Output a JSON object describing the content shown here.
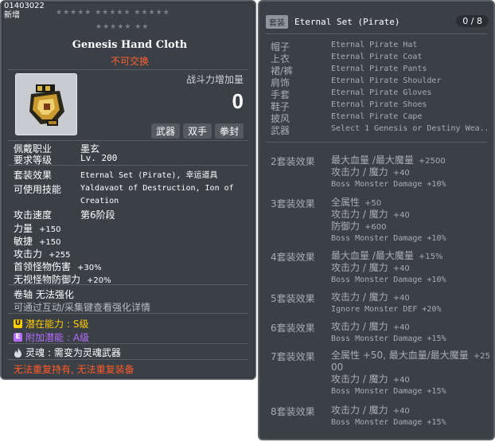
{
  "item": {
    "id": "01403022",
    "new_label": "新增",
    "stars_row1": "★★★★★ ★★★★★ ★★★★★",
    "stars_row2": "★★★★★ ★★",
    "name": "Genesis Hand Cloth",
    "trade_status": "不可交换",
    "power_label": "战斗力增加量",
    "power_value": "0",
    "tags": [
      "武器",
      "双手",
      "拳封"
    ],
    "icon": "gloves-icon"
  },
  "requirements": [
    {
      "key": "佩戴职业",
      "value": "墨玄"
    },
    {
      "key": "要求等级",
      "value": "Lv. 200"
    }
  ],
  "set_effect": {
    "key": "套装效果",
    "value": "Eternal Set (Pirate), 幸运道具"
  },
  "skills": {
    "key": "可使用技能",
    "value": "Yaldavaot of Destruction, Ion of Creation"
  },
  "attack_speed": {
    "key": "攻击速度",
    "value": "第6阶段"
  },
  "stats": [
    {
      "name": "力量",
      "value": "+150"
    },
    {
      "name": "敏捷",
      "value": "+150"
    },
    {
      "name": "攻击力",
      "value": "+255"
    },
    {
      "name": "首领怪物伤害",
      "value": "+30%"
    },
    {
      "name": "无视怪物防御力",
      "value": "+20%"
    }
  ],
  "scroll": {
    "label": "卷轴",
    "value": "无法强化"
  },
  "enhance_hint": "可通过互动/采集键查看强化详情",
  "potential": {
    "badge": "U",
    "label": "潜在能力",
    "value": ": S级",
    "color": "#ffcc00"
  },
  "bonus_potential": {
    "badge": "E",
    "label": "附加潜能",
    "value": ": A级",
    "color": "#b56cff"
  },
  "soul": {
    "label": "灵魂",
    "value": ": 需变为灵魂武器"
  },
  "warning": "无法重复持有, 无法重复装备",
  "set": {
    "badge": "套装",
    "title": "Eternal Set (Pirate)",
    "count": "0 / 8",
    "pieces": [
      {
        "slot": "帽子",
        "name": "Eternal Pirate Hat"
      },
      {
        "slot": "上衣",
        "name": "Eternal Pirate Coat"
      },
      {
        "slot": "裙/裤",
        "name": "Eternal Pirate Pants"
      },
      {
        "slot": "肩饰",
        "name": "Eternal Pirate Shoulder"
      },
      {
        "slot": "手套",
        "name": "Eternal Pirate Gloves"
      },
      {
        "slot": "鞋子",
        "name": "Eternal Pirate Shoes"
      },
      {
        "slot": "披风",
        "name": "Eternal Pirate Cape"
      },
      {
        "slot": "武器",
        "name": "Select 1 Genesis or Destiny Wea.."
      }
    ],
    "bonuses": [
      {
        "label": "2套装效果",
        "lines": [
          {
            "text": "最大血量 /最大魔量",
            "num": "+2500"
          },
          {
            "text": "攻击力 / 魔力",
            "num": "+40"
          },
          {
            "mono": "Boss Monster Damage +10%"
          }
        ]
      },
      {
        "label": "3套装效果",
        "lines": [
          {
            "text": "全属性",
            "num": "+50"
          },
          {
            "text": "攻击力 / 魔力",
            "num": "+40"
          },
          {
            "text": "防御力",
            "num": "+600"
          },
          {
            "mono": "Boss Monster Damage +10%"
          }
        ]
      },
      {
        "label": "4套装效果",
        "lines": [
          {
            "text": "最大血量 /最大魔量",
            "num": "+15%"
          },
          {
            "text": "攻击力 / 魔力",
            "num": "+40"
          },
          {
            "mono": "Boss Monster Damage +10%"
          }
        ]
      },
      {
        "label": "5套装效果",
        "lines": [
          {
            "text": "攻击力 / 魔力",
            "num": "+40"
          },
          {
            "mono": "Ignore Monster DEF +20%"
          }
        ]
      },
      {
        "label": "6套装效果",
        "lines": [
          {
            "text": "攻击力 / 魔力",
            "num": "+40"
          },
          {
            "mono": "Boss Monster Damage +15%"
          }
        ]
      },
      {
        "label": "7套装效果",
        "lines": [
          {
            "text": "全属性 +50, 最大血量/最大魔量",
            "num": "+25"
          },
          {
            "text": "00",
            "num": ""
          },
          {
            "text": "攻击力 / 魔力",
            "num": "+40"
          },
          {
            "mono": "Boss Monster Damage +15%"
          }
        ]
      },
      {
        "label": "8套装效果",
        "lines": [
          {
            "text": "攻击力 / 魔力",
            "num": "+40"
          },
          {
            "mono": "Boss Monster Damage +15%"
          }
        ]
      }
    ]
  }
}
